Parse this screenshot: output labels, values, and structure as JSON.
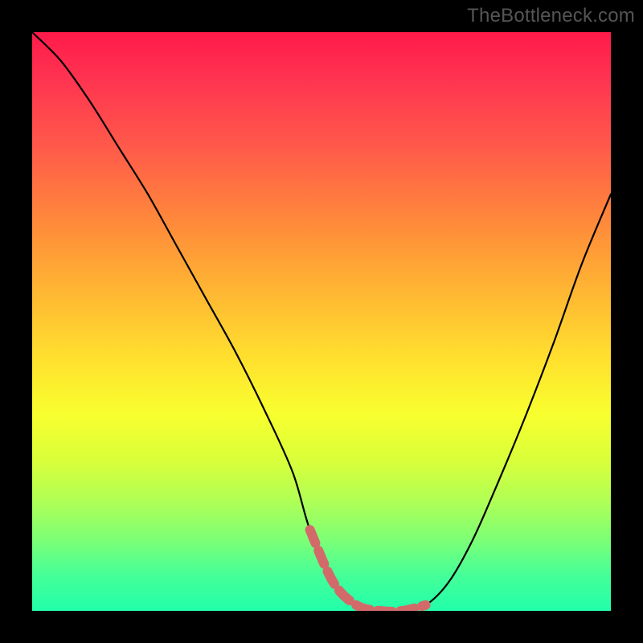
{
  "watermark": "TheBottleneck.com",
  "chart_data": {
    "type": "line",
    "title": "",
    "xlabel": "",
    "ylabel": "",
    "xlim": [
      0,
      100
    ],
    "ylim": [
      0,
      100
    ],
    "grid": false,
    "legend": false,
    "background": {
      "type": "vertical-gradient",
      "stops": [
        {
          "pos": 0,
          "color": "#ff1a4a"
        },
        {
          "pos": 20,
          "color": "#ff5a4a"
        },
        {
          "pos": 45,
          "color": "#ffb733"
        },
        {
          "pos": 66,
          "color": "#f8ff2e"
        },
        {
          "pos": 88,
          "color": "#7aff77"
        },
        {
          "pos": 100,
          "color": "#22ffaa"
        }
      ]
    },
    "series": [
      {
        "name": "bottleneck-curve",
        "color": "#000000",
        "x": [
          0,
          5,
          10,
          15,
          20,
          25,
          30,
          35,
          40,
          45,
          48,
          52,
          56,
          60,
          64,
          68,
          72,
          76,
          80,
          85,
          90,
          95,
          100
        ],
        "y": [
          100,
          95,
          88,
          80,
          72,
          63,
          54,
          45,
          35,
          24,
          14,
          5,
          1,
          0,
          0,
          1,
          5,
          12,
          21,
          33,
          46,
          60,
          72
        ]
      },
      {
        "name": "highlight-band",
        "color": "#d36a6a",
        "x": [
          48,
          52,
          56,
          60,
          64,
          68
        ],
        "y": [
          14,
          5,
          1,
          0,
          0,
          1
        ]
      }
    ],
    "annotations": []
  }
}
